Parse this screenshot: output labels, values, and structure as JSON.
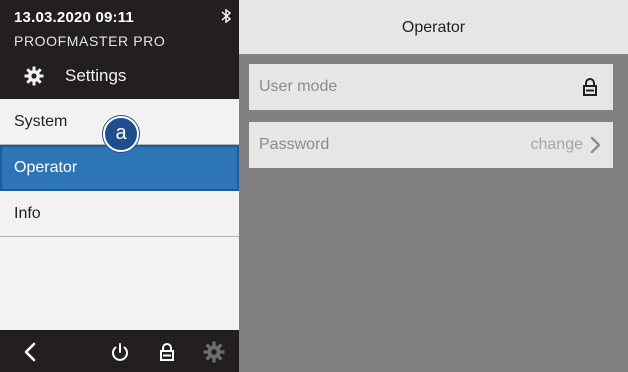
{
  "status": {
    "datetime": "13.03.2020 09:11",
    "device_name": "PROOFMASTER PRO",
    "bluetooth_icon": "bluetooth-icon"
  },
  "sidebar": {
    "title": "Settings",
    "title_icon": "gear-icon",
    "items": [
      {
        "label": "System",
        "active": false
      },
      {
        "label": "Operator",
        "active": true
      },
      {
        "label": "Info",
        "active": false
      }
    ],
    "callout": "a"
  },
  "footer": {
    "icons": [
      "back-chevron-icon",
      "power-icon",
      "lock-icon",
      "gear-icon"
    ]
  },
  "main": {
    "title": "Operator",
    "rows": [
      {
        "label": "User mode",
        "value": "",
        "icon": "lock-icon"
      },
      {
        "label": "Password",
        "value": "change",
        "icon": "chevron-right-icon"
      }
    ]
  },
  "colors": {
    "dark": "#231f20",
    "accent": "#2e75b5",
    "badge": "#1f4e8c",
    "content_bg": "#808080",
    "row_bg": "#e6e6e6"
  }
}
